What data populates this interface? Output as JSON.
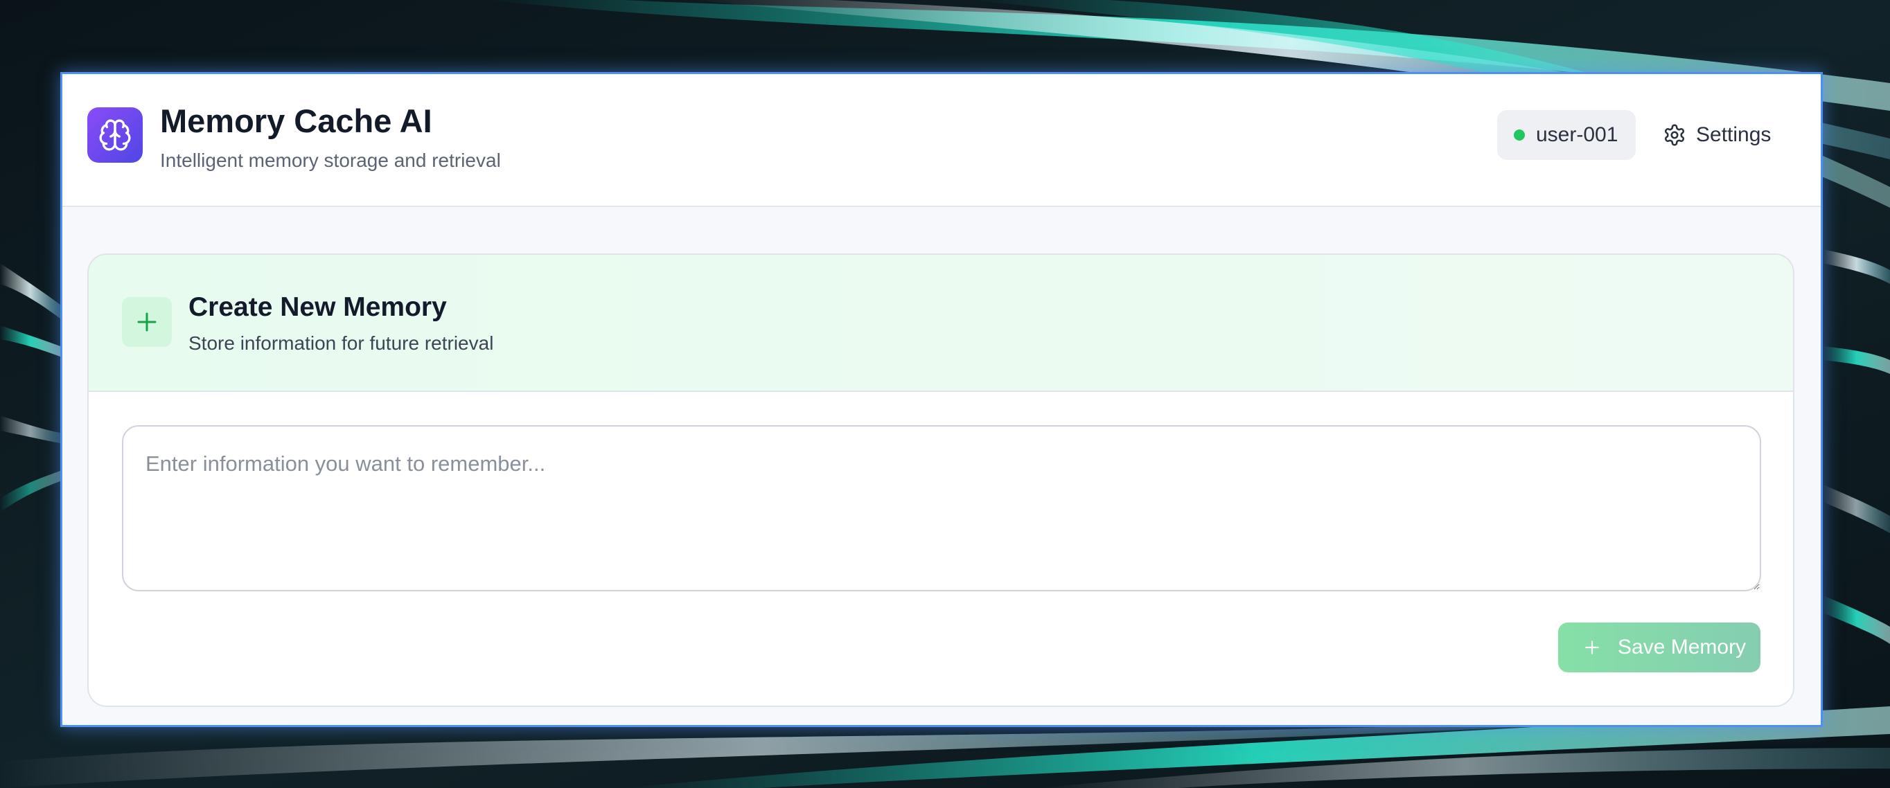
{
  "app": {
    "title": "Memory Cache AI",
    "subtitle": "Intelligent memory storage and retrieval",
    "logo_icon": "brain-icon"
  },
  "header": {
    "user": {
      "label": "user-001",
      "status_color": "#22c55e",
      "status": "online"
    },
    "settings_label": "Settings",
    "settings_icon": "gear-icon"
  },
  "create_memory": {
    "title": "Create New Memory",
    "subtitle": "Store information for future retrieval",
    "icon": "plus-icon",
    "input": {
      "value": "",
      "placeholder": "Enter information you want to remember..."
    },
    "save_label": "Save Memory",
    "save_enabled": false
  },
  "colors": {
    "accent_purple": "#8b4cf6",
    "accent_indigo": "#4f46e5",
    "accent_green": "#22c55e",
    "window_border": "#4f8ff0"
  }
}
